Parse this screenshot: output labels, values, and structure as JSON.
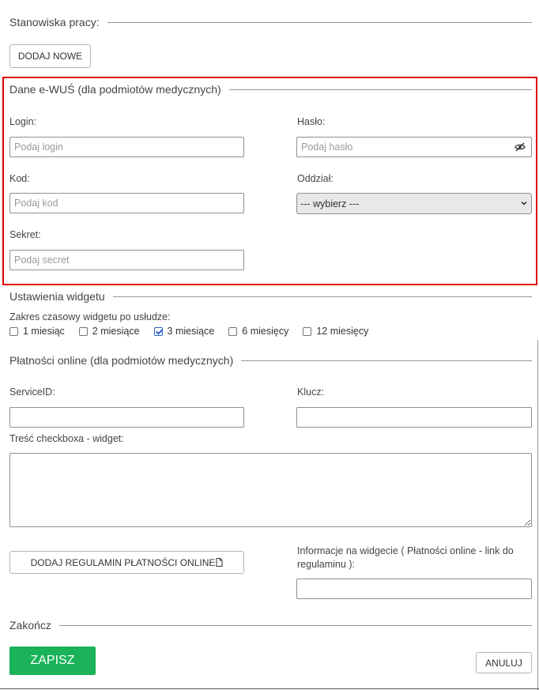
{
  "workstations": {
    "heading": "Stanowiska pracy:",
    "add_new": "DODAJ NOWE"
  },
  "ewus": {
    "heading": "Dane e-WUŚ (dla podmiotów medycznych)",
    "login_label": "Login:",
    "login_placeholder": "Podaj login",
    "password_label": "Hasło:",
    "password_placeholder": "Podaj hasło",
    "code_label": "Kod:",
    "code_placeholder": "Podaj kod",
    "branch_label": "Oddział:",
    "branch_selected": "--- wybierz ---",
    "secret_label": "Sekret:",
    "secret_placeholder": "Podaj secret"
  },
  "widget": {
    "heading": "Ustawienia widgetu",
    "range_label": "Zakres czasowy widgetu po usłudze:",
    "options": [
      {
        "label": "1 miesiąc",
        "checked": false
      },
      {
        "label": "2 miesiące",
        "checked": false
      },
      {
        "label": "3 miesiące",
        "checked": true
      },
      {
        "label": "6 miesięcy",
        "checked": false
      },
      {
        "label": "12 miesięcy",
        "checked": false
      }
    ]
  },
  "payments": {
    "heading": "Płatności online (dla podmiotów medycznych)",
    "service_label": "ServiceID:",
    "key_label": "Klucz:",
    "checkbox_text_label": "Treść checkboxa - widget:",
    "add_terms": "DODAJ REGULAMIN PŁATNOŚCI ONLINE",
    "info_label": "Informacje na widgecie ( Płatności online - link do regulaminu ):"
  },
  "finish": {
    "heading": "Zakończ",
    "save": "ZAPISZ",
    "cancel": "ANULUJ"
  },
  "colors": {
    "highlight": "#e00000",
    "save_bg": "#1ab35a",
    "line": "#8a96a0",
    "checkbox": "#2a63c7"
  }
}
